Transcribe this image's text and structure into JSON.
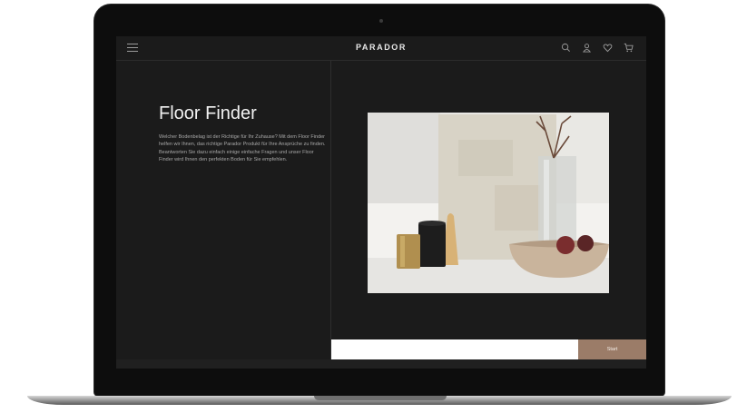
{
  "header": {
    "brand": "PARADOR",
    "icons": [
      "menu-icon",
      "search-icon",
      "user-icon",
      "heart-icon",
      "cart-icon"
    ]
  },
  "left_panel": {
    "title": "Floor Finder",
    "intro": "Welcher Bodenbelag ist der Richtige für Ihr Zuhause? Mit dem Floor Finder helfen wir Ihnen, das richtige Parador Produkt für Ihre Ansprüche zu finden. Beantworten Sie dazu einfach einige einfache Fragen und unser Floor Finder wird Ihnen den perfekten Boden für Sie empfehlen."
  },
  "main": {
    "input_value": "",
    "start_label": "Start"
  },
  "colors": {
    "screen_bg": "#1b1b1b",
    "accent": "#9b7c68",
    "text_light": "#f2f2f2"
  }
}
